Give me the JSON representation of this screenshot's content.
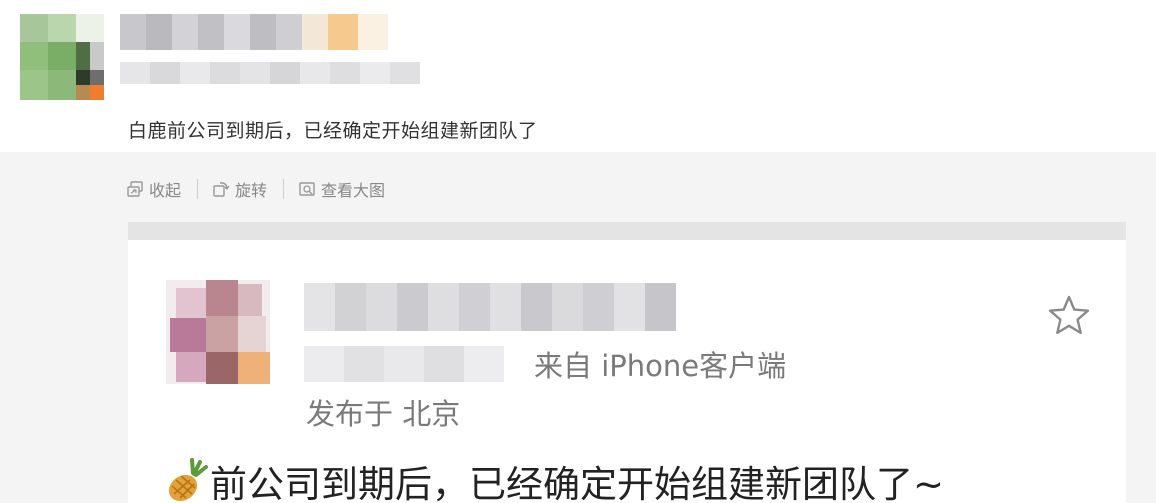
{
  "post": {
    "text": "白鹿前公司到期后，已经确定开始组建新团队了"
  },
  "toolbar": {
    "collapse_label": "收起",
    "rotate_label": "旋转",
    "view_large_label": "查看大图"
  },
  "card": {
    "source": "来自 iPhone客户端",
    "location": "发布于 北京",
    "content": "前公司到期后，已经确定开始组建新团队了~"
  },
  "colors": {
    "background": "#ffffff",
    "gray_area": "#f4f4f4",
    "meta_text": "#7a7a7a",
    "toolbar_text": "#888888"
  },
  "icons": [
    "collapse-icon",
    "rotate-icon",
    "view-large-icon",
    "star-icon",
    "pineapple-emoji"
  ]
}
